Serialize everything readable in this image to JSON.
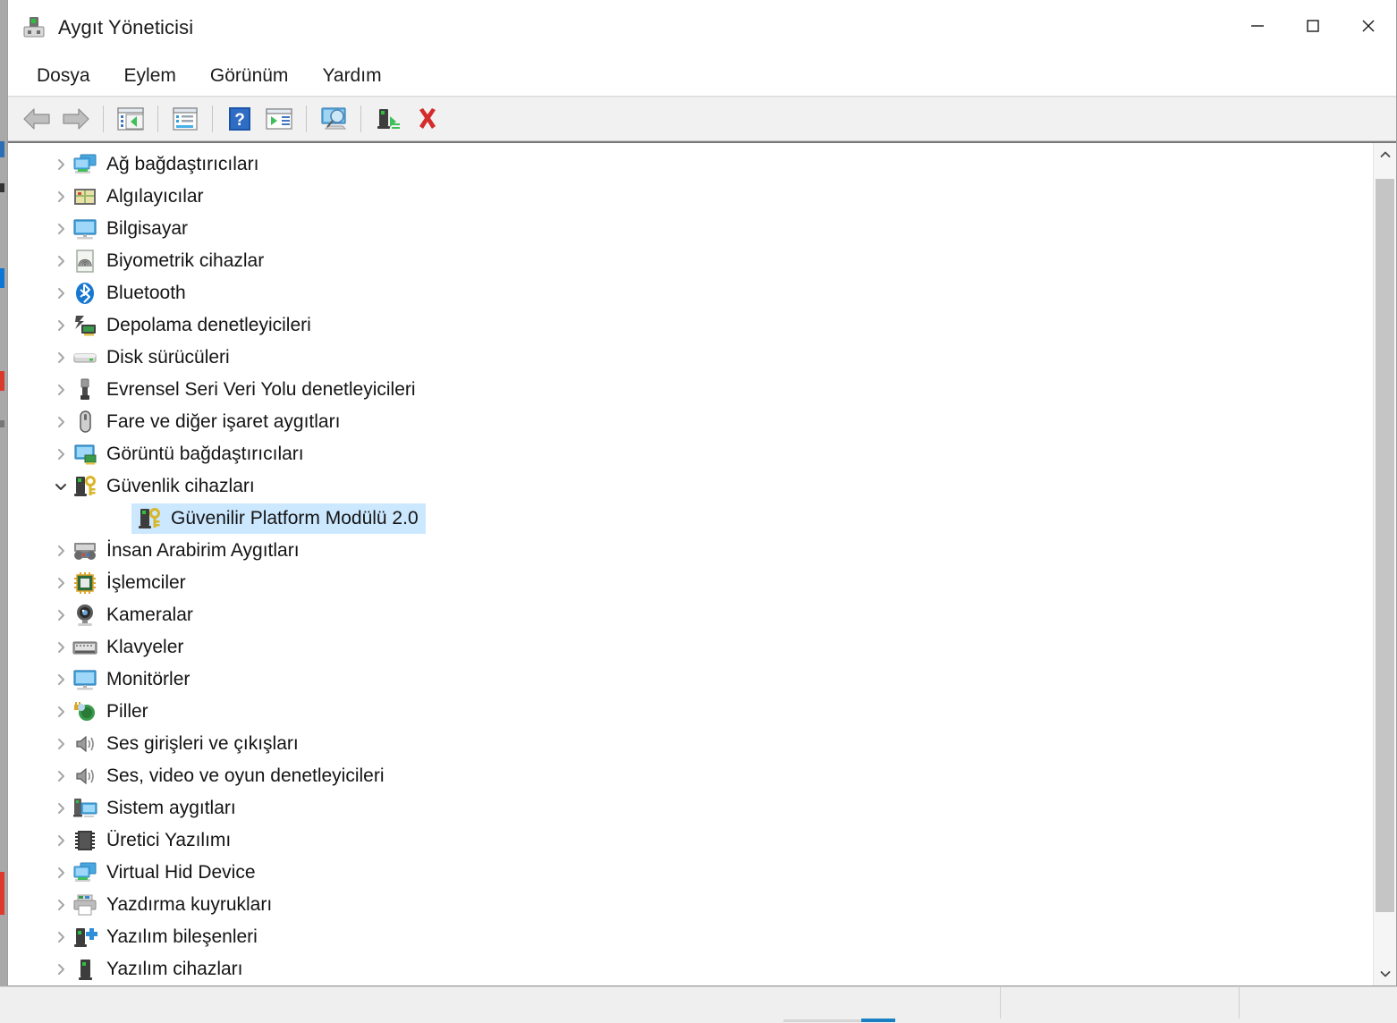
{
  "window": {
    "title": "Aygıt Yöneticisi",
    "icon": "device-manager-icon",
    "controls": {
      "minimize": "minimize-icon",
      "maximize": "maximize-icon",
      "close": "close-icon"
    }
  },
  "menubar": {
    "items": [
      {
        "label": "Dosya",
        "name": "menu-dosya"
      },
      {
        "label": "Eylem",
        "name": "menu-eylem"
      },
      {
        "label": "Görünüm",
        "name": "menu-gorunum"
      },
      {
        "label": "Yardım",
        "name": "menu-yardim"
      }
    ]
  },
  "toolbar": {
    "buttons": [
      {
        "icon": "back-arrow-icon",
        "title": "Geri"
      },
      {
        "icon": "forward-arrow-icon",
        "title": "İleri"
      },
      {
        "icon": "show-hide-console-tree-icon",
        "title": "Konsol ağacını göster/gizle"
      },
      {
        "icon": "properties-icon",
        "title": "Özellikler"
      },
      {
        "icon": "help-icon",
        "title": "Yardım"
      },
      {
        "icon": "update-driver-icon",
        "title": "Sürücüyü güncelleştir"
      },
      {
        "icon": "scan-hardware-changes-icon",
        "title": "Donanım değişikliklerini tara"
      },
      {
        "icon": "enable-device-icon",
        "title": "Aygıtı etkinleştir"
      },
      {
        "icon": "uninstall-device-icon",
        "title": "Aygıtı kaldır"
      }
    ]
  },
  "tree": {
    "items": [
      {
        "label": "Ağ bağdaştırıcıları",
        "icon": "network-adapter-icon",
        "expanded": false,
        "level": 0,
        "selected": false
      },
      {
        "label": "Algılayıcılar",
        "icon": "sensors-icon",
        "expanded": false,
        "level": 0,
        "selected": false
      },
      {
        "label": "Bilgisayar",
        "icon": "computer-icon",
        "expanded": false,
        "level": 0,
        "selected": false
      },
      {
        "label": "Biyometrik cihazlar",
        "icon": "fingerprint-icon",
        "expanded": false,
        "level": 0,
        "selected": false
      },
      {
        "label": "Bluetooth",
        "icon": "bluetooth-icon",
        "expanded": false,
        "level": 0,
        "selected": false
      },
      {
        "label": "Depolama denetleyicileri",
        "icon": "storage-controller-icon",
        "expanded": false,
        "level": 0,
        "selected": false
      },
      {
        "label": "Disk sürücüleri",
        "icon": "disk-drive-icon",
        "expanded": false,
        "level": 0,
        "selected": false
      },
      {
        "label": "Evrensel Seri Veri Yolu denetleyicileri",
        "icon": "usb-icon",
        "expanded": false,
        "level": 0,
        "selected": false
      },
      {
        "label": "Fare ve diğer işaret aygıtları",
        "icon": "mouse-icon",
        "expanded": false,
        "level": 0,
        "selected": false
      },
      {
        "label": "Görüntü bağdaştırıcıları",
        "icon": "display-adapter-icon",
        "expanded": false,
        "level": 0,
        "selected": false
      },
      {
        "label": "Güvenlik cihazları",
        "icon": "security-device-icon",
        "expanded": true,
        "level": 0,
        "selected": false
      },
      {
        "label": "Güvenilir Platform Modülü 2.0",
        "icon": "security-device-icon",
        "expanded": null,
        "level": 1,
        "selected": true
      },
      {
        "label": "İnsan Arabirim Aygıtları",
        "icon": "hid-icon",
        "expanded": false,
        "level": 0,
        "selected": false
      },
      {
        "label": "İşlemciler",
        "icon": "processor-icon",
        "expanded": false,
        "level": 0,
        "selected": false
      },
      {
        "label": "Kameralar",
        "icon": "camera-icon",
        "expanded": false,
        "level": 0,
        "selected": false
      },
      {
        "label": "Klavyeler",
        "icon": "keyboard-icon",
        "expanded": false,
        "level": 0,
        "selected": false
      },
      {
        "label": "Monitörler",
        "icon": "monitor-icon",
        "expanded": false,
        "level": 0,
        "selected": false
      },
      {
        "label": "Piller",
        "icon": "battery-icon",
        "expanded": false,
        "level": 0,
        "selected": false
      },
      {
        "label": "Ses girişleri ve çıkışları",
        "icon": "speaker-icon",
        "expanded": false,
        "level": 0,
        "selected": false
      },
      {
        "label": "Ses, video ve oyun denetleyicileri",
        "icon": "speaker-icon",
        "expanded": false,
        "level": 0,
        "selected": false
      },
      {
        "label": "Sistem aygıtları",
        "icon": "system-device-icon",
        "expanded": false,
        "level": 0,
        "selected": false
      },
      {
        "label": "Üretici Yazılımı",
        "icon": "firmware-icon",
        "expanded": false,
        "level": 0,
        "selected": false
      },
      {
        "label": "Virtual Hid Device",
        "icon": "network-adapter-icon",
        "expanded": false,
        "level": 0,
        "selected": false
      },
      {
        "label": "Yazdırma kuyrukları",
        "icon": "printer-icon",
        "expanded": false,
        "level": 0,
        "selected": false
      },
      {
        "label": "Yazılım bileşenleri",
        "icon": "software-component-icon",
        "expanded": false,
        "level": 0,
        "selected": false
      },
      {
        "label": "Yazılım cihazları",
        "icon": "software-device-icon",
        "expanded": false,
        "level": 0,
        "selected": false
      }
    ]
  },
  "scrollbar": {
    "up": "chevron-up-icon",
    "down": "chevron-down-icon"
  },
  "statusbar": {
    "segments": [
      "",
      "",
      ""
    ]
  },
  "colors": {
    "selection": "#cce8ff",
    "accent": "#0a78d4",
    "window_bg": "#ffffff",
    "toolbar_bg": "#f1f1f1",
    "status_bg": "#efefef"
  }
}
